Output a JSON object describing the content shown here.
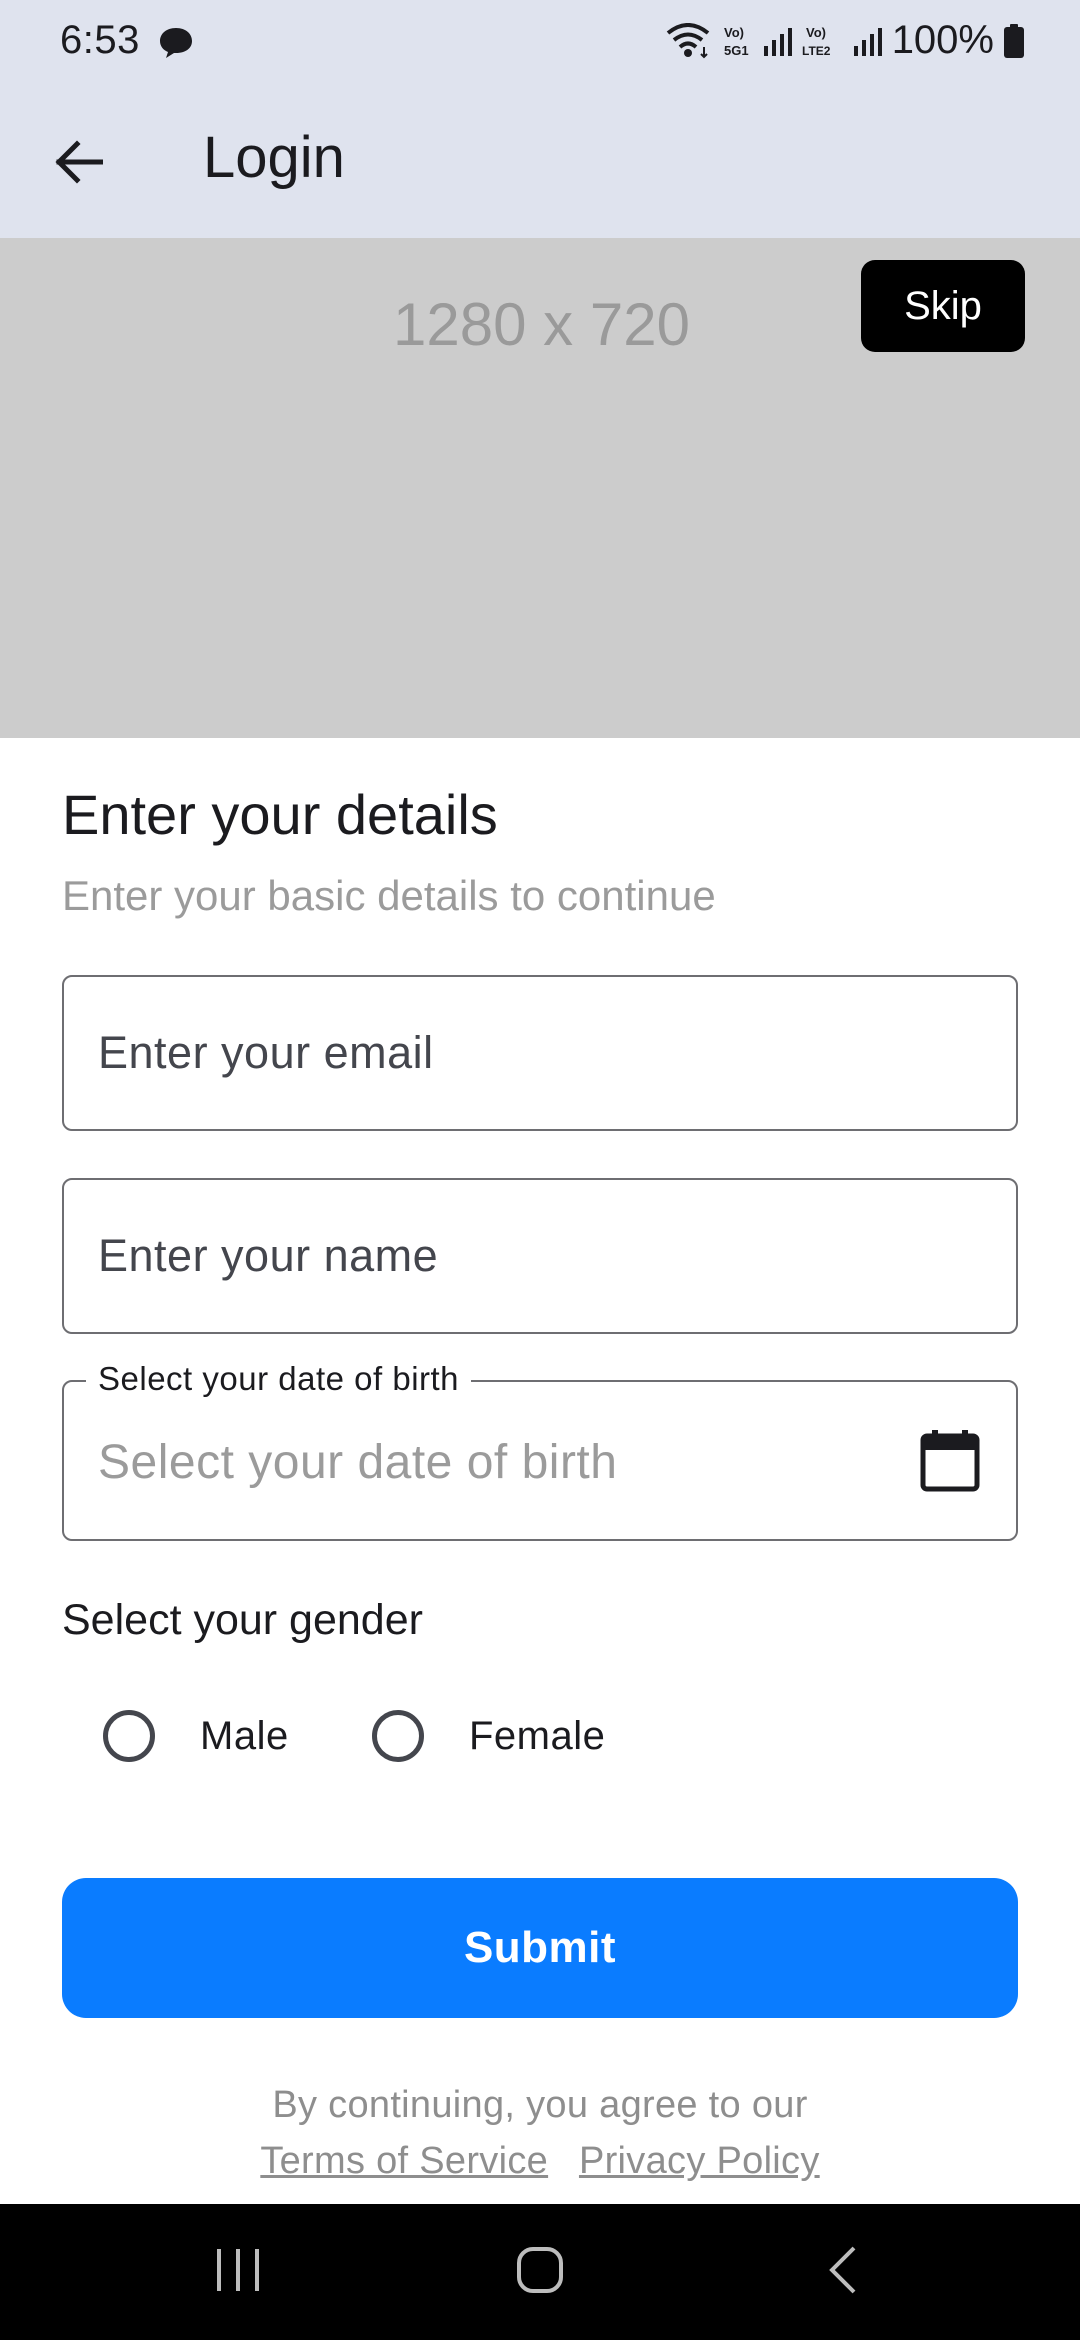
{
  "status_bar": {
    "time": "6:53",
    "battery": "100%",
    "icons": [
      "message-icon",
      "wifi-icon",
      "volte-5g-icon",
      "signal-icon",
      "volte-lte2-icon",
      "signal-icon",
      "battery-icon"
    ]
  },
  "app_bar": {
    "title": "Login",
    "back_icon": "arrow-left-icon"
  },
  "hero": {
    "placeholder_text": "1280 x 720",
    "skip_label": "Skip",
    "background_color": "#cccccc"
  },
  "form": {
    "heading": "Enter your details",
    "subheading": "Enter your basic details to continue",
    "email_placeholder": "Enter your email",
    "name_placeholder": "Enter your name",
    "dob_label": "Select your date of birth",
    "dob_placeholder": "Select your date of birth",
    "dob_icon": "calendar-icon",
    "gender_title": "Select your gender",
    "gender_options": [
      {
        "label": "Male",
        "selected": false
      },
      {
        "label": "Female",
        "selected": false
      }
    ],
    "submit_label": "Submit",
    "submit_color": "#0a7cff"
  },
  "footer": {
    "agree_text": "By continuing, you agree to our",
    "terms_link": "Terms of Service",
    "privacy_link": "Privacy Policy"
  },
  "nav_bar": {
    "buttons": [
      "recents-icon",
      "home-icon",
      "back-icon"
    ]
  }
}
